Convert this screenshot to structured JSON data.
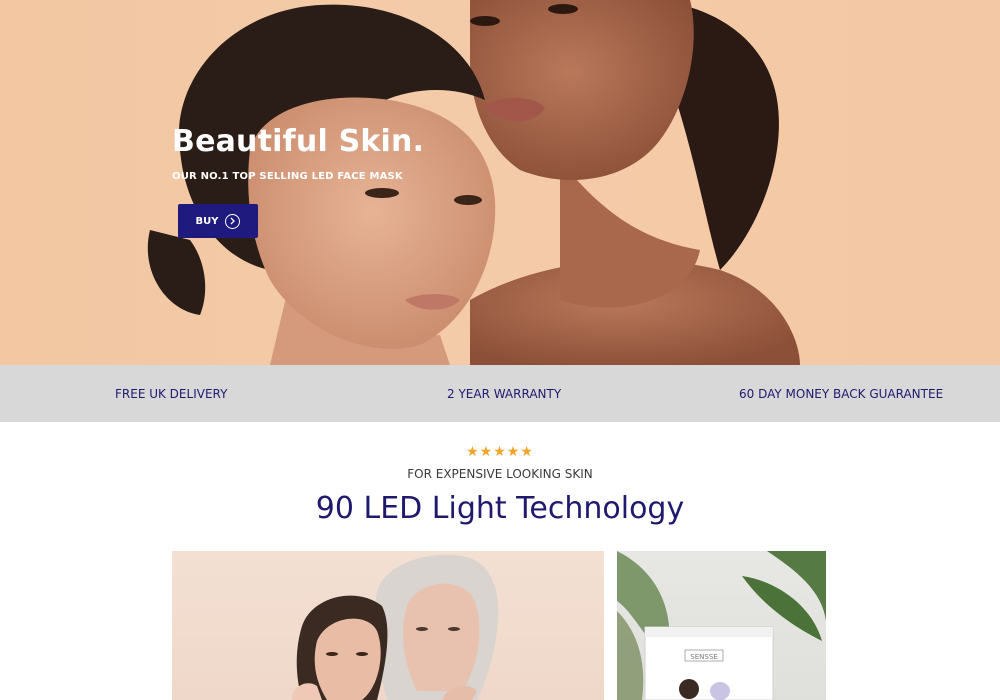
{
  "hero": {
    "title": "Beautiful Skin.",
    "subtitle": "OUR NO.1 TOP SELLING LED FACE MASK",
    "buy_label": "BUY",
    "buy_icon": "chevron-right-circle-icon"
  },
  "usp": {
    "delivery": "FREE UK DELIVERY",
    "warranty": "2 YEAR WARRANTY",
    "guarantee": "60 DAY MONEY BACK GUARANTEE"
  },
  "section": {
    "stars": "★★★★★",
    "rating": 5,
    "eyebrow": "FOR EXPENSIVE LOOKING SKIN",
    "title": "90 LED Light Technology"
  },
  "product_box": {
    "brand": "SENSSE"
  },
  "colors": {
    "primary": "#1f1a7e",
    "text_dark_blue": "#1f1a6e",
    "hero_background": "#f2c7a2",
    "usp_bar_background": "#d8d8d8",
    "star": "#f0a52a"
  }
}
